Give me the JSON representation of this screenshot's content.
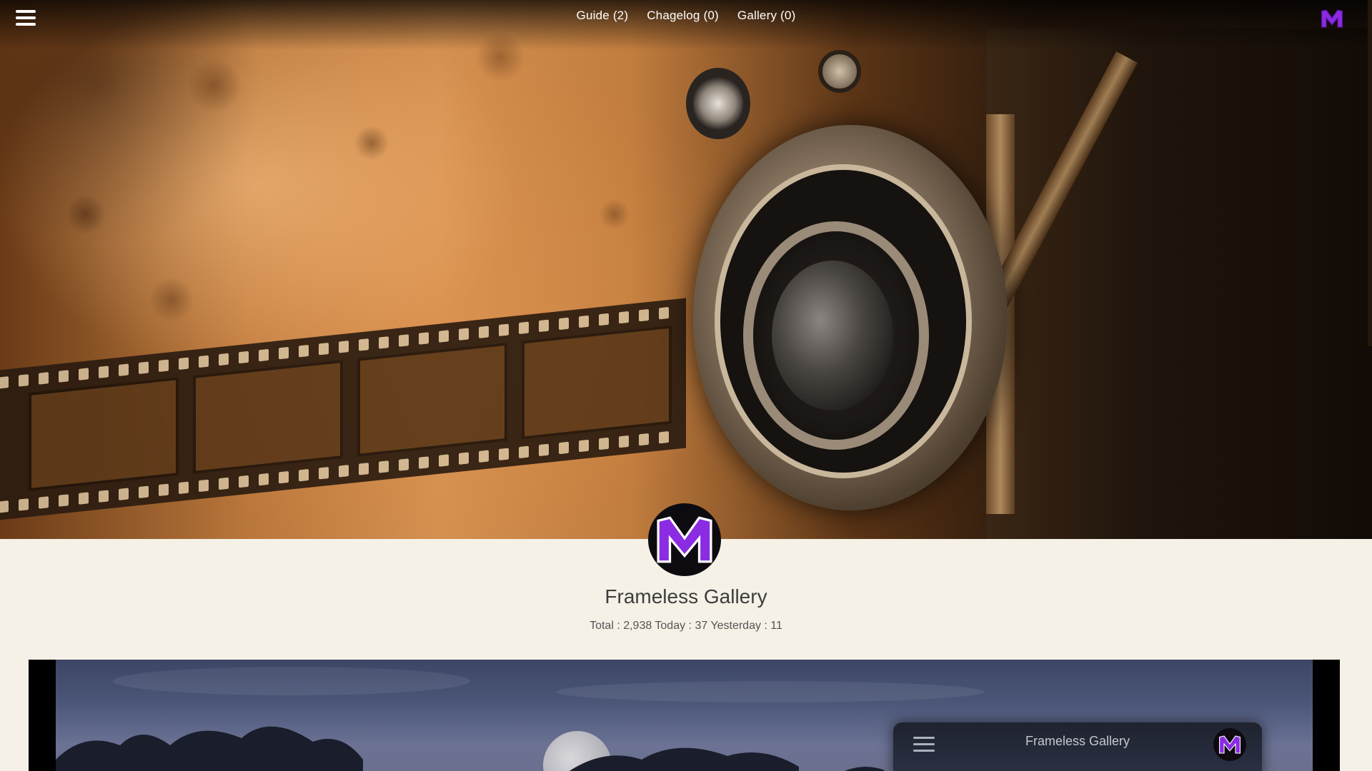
{
  "header": {
    "nav": [
      {
        "label": "Guide  (2)"
      },
      {
        "label": "Chagelog  (0)"
      },
      {
        "label": "Gallery  (0)"
      }
    ]
  },
  "profile": {
    "title": "Frameless Gallery",
    "stats": "Total : 2,938 Today : 37 Yesterday : 11"
  },
  "preview": {
    "mini_title": "Frameless Gallery"
  },
  "icons": {
    "menu": "menu-icon",
    "logo": "m-logo-icon"
  },
  "colors": {
    "page_background": "#f5f1e6",
    "logo_purple": "#8b2be2",
    "logo_background": "#0d0b10"
  }
}
